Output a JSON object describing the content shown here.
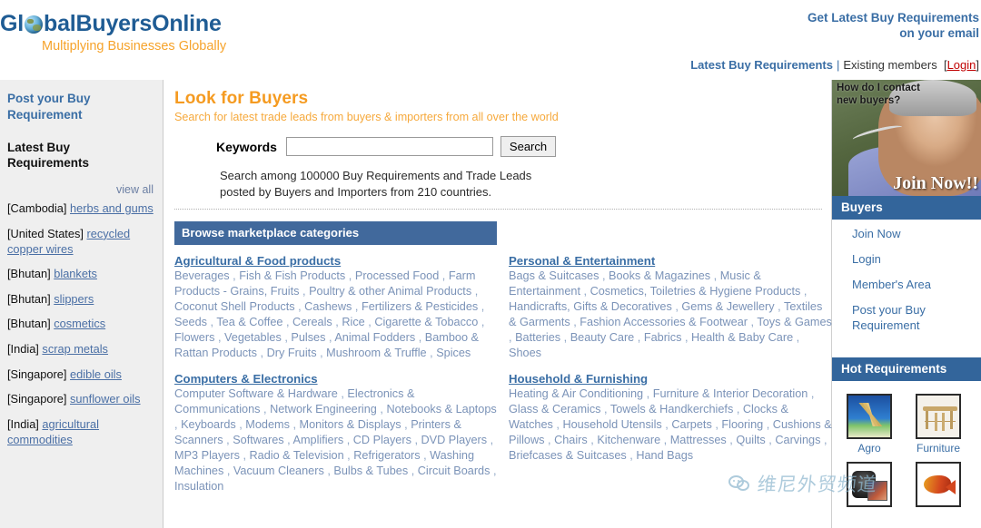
{
  "header": {
    "logo_text_pre": "Gl",
    "logo_text_post": "balBuyersOnline",
    "logo_icon": "globe-icon",
    "tagline": "Multiplying Businesses Globally",
    "promo_line1": "Get Latest Buy Requirements",
    "promo_line2": "on your email",
    "nav": {
      "latest_buy_requirements": "Latest Buy Requirements",
      "separator": "|",
      "existing_members": "Existing members",
      "bracket_open": "[",
      "login": "Login",
      "bracket_close": "]"
    }
  },
  "left_sidebar": {
    "post_requirement": "Post your Buy Requirement",
    "latest_heading": "Latest Buy Requirements",
    "view_all": "view all",
    "requirements": [
      {
        "country": "[Cambodia]",
        "item": "herbs and gums"
      },
      {
        "country": "[United States]",
        "item": "recycled copper wires"
      },
      {
        "country": "[Bhutan]",
        "item": "blankets"
      },
      {
        "country": "[Bhutan]",
        "item": "slippers"
      },
      {
        "country": "[Bhutan]",
        "item": "cosmetics"
      },
      {
        "country": "[India]",
        "item": "scrap metals"
      },
      {
        "country": "[Singapore]",
        "item": "edible oils"
      },
      {
        "country": "[Singapore]",
        "item": "sunflower oils"
      },
      {
        "country": "[India]",
        "item": "agricultural commodities"
      }
    ]
  },
  "main": {
    "title": "Look for Buyers",
    "subtitle": "Search for latest trade leads from buyers & importers from all over the world",
    "search": {
      "label": "Keywords",
      "value": "",
      "placeholder": "",
      "button": "Search"
    },
    "search_note_line1": "Search among 100000 Buy Requirements and Trade Leads",
    "search_note_line2": "posted by Buyers and Importers from 210 countries.",
    "browse_bar": "Browse marketplace categories",
    "categories": [
      {
        "title": "Agricultural & Food products",
        "items": [
          "Beverages",
          "Fish & Fish Products",
          "Processed Food",
          "Farm Products - Grains, Fruits",
          "Poultry & other Animal Products",
          "Coconut Shell Products",
          "Cashews",
          "Fertilizers & Pesticides",
          "Seeds",
          "Tea & Coffee",
          "Cereals",
          "Rice",
          "Cigarette & Tobacco",
          "Flowers",
          "Vegetables",
          "Pulses",
          "Animal Fodders",
          "Bamboo & Rattan Products",
          "Dry Fruits",
          "Mushroom & Truffle",
          "Spices"
        ]
      },
      {
        "title": "Personal & Entertainment",
        "items": [
          "Bags & Suitcases",
          "Books & Magazines",
          "Music & Entertainment",
          "Cosmetics, Toiletries & Hygiene Products",
          "Handicrafts, Gifts & Decoratives",
          "Gems & Jewellery",
          "Textiles & Garments",
          "Fashion Accessories & Footwear",
          "Toys & Games",
          "Batteries",
          "Beauty Care",
          "Fabrics",
          "Health & Baby Care",
          "Shoes"
        ]
      },
      {
        "title": "Computers & Electronics",
        "items": [
          "Computer Software & Hardware",
          "Electronics & Communications",
          "Network Engineering",
          "Notebooks & Laptops",
          "Keyboards",
          "Modems",
          "Monitors & Displays",
          "Printers & Scanners",
          "Softwares",
          "Amplifiers",
          "CD Players",
          "DVD Players",
          "MP3 Players",
          "Radio & Television",
          "Refrigerators",
          "Washing Machines",
          "Vacuum Cleaners",
          "Bulbs & Tubes",
          "Circuit Boards",
          "Insulation"
        ]
      },
      {
        "title": "Household & Furnishing",
        "items": [
          "Heating & Air Conditioning",
          "Furniture & Interior Decoration",
          "Glass & Ceramics",
          "Towels & Handkerchiefs",
          "Clocks & Watches",
          "Household Utensils",
          "Carpets",
          "Flooring",
          "Cushions & Pillows",
          "Chairs",
          "Kitchenware",
          "Mattresses",
          "Quilts",
          "Carvings",
          "Briefcases & Suitcases",
          "Hand Bags"
        ]
      }
    ]
  },
  "right_sidebar": {
    "promo": {
      "question_line1": "How do I contact",
      "question_line2": "new buyers?",
      "join_now": "Join Now!!"
    },
    "buyers_bar": "Buyers",
    "buyers_links": [
      "Join Now",
      "Login",
      "Member's Area",
      "Post your Buy Requirement"
    ],
    "hot_bar": "Hot Requirements",
    "hot_items": [
      {
        "label": "Agro",
        "icon": "agro-thumbnail"
      },
      {
        "label": "Furniture",
        "icon": "furniture-thumbnail"
      },
      {
        "label": "",
        "icon": "electronics-thumbnail"
      },
      {
        "label": "",
        "icon": "fish-thumbnail"
      }
    ]
  },
  "watermark": {
    "text": "维尼外贸频道",
    "icon": "wechat-logo-icon"
  },
  "colors": {
    "brand_blue": "#3A6EA5",
    "bar_blue": "#41699C",
    "accent_orange": "#F59B21",
    "link_muted": "#7B93B8",
    "login_red": "#C00000",
    "sidebar_bg": "#EFEFEF"
  }
}
